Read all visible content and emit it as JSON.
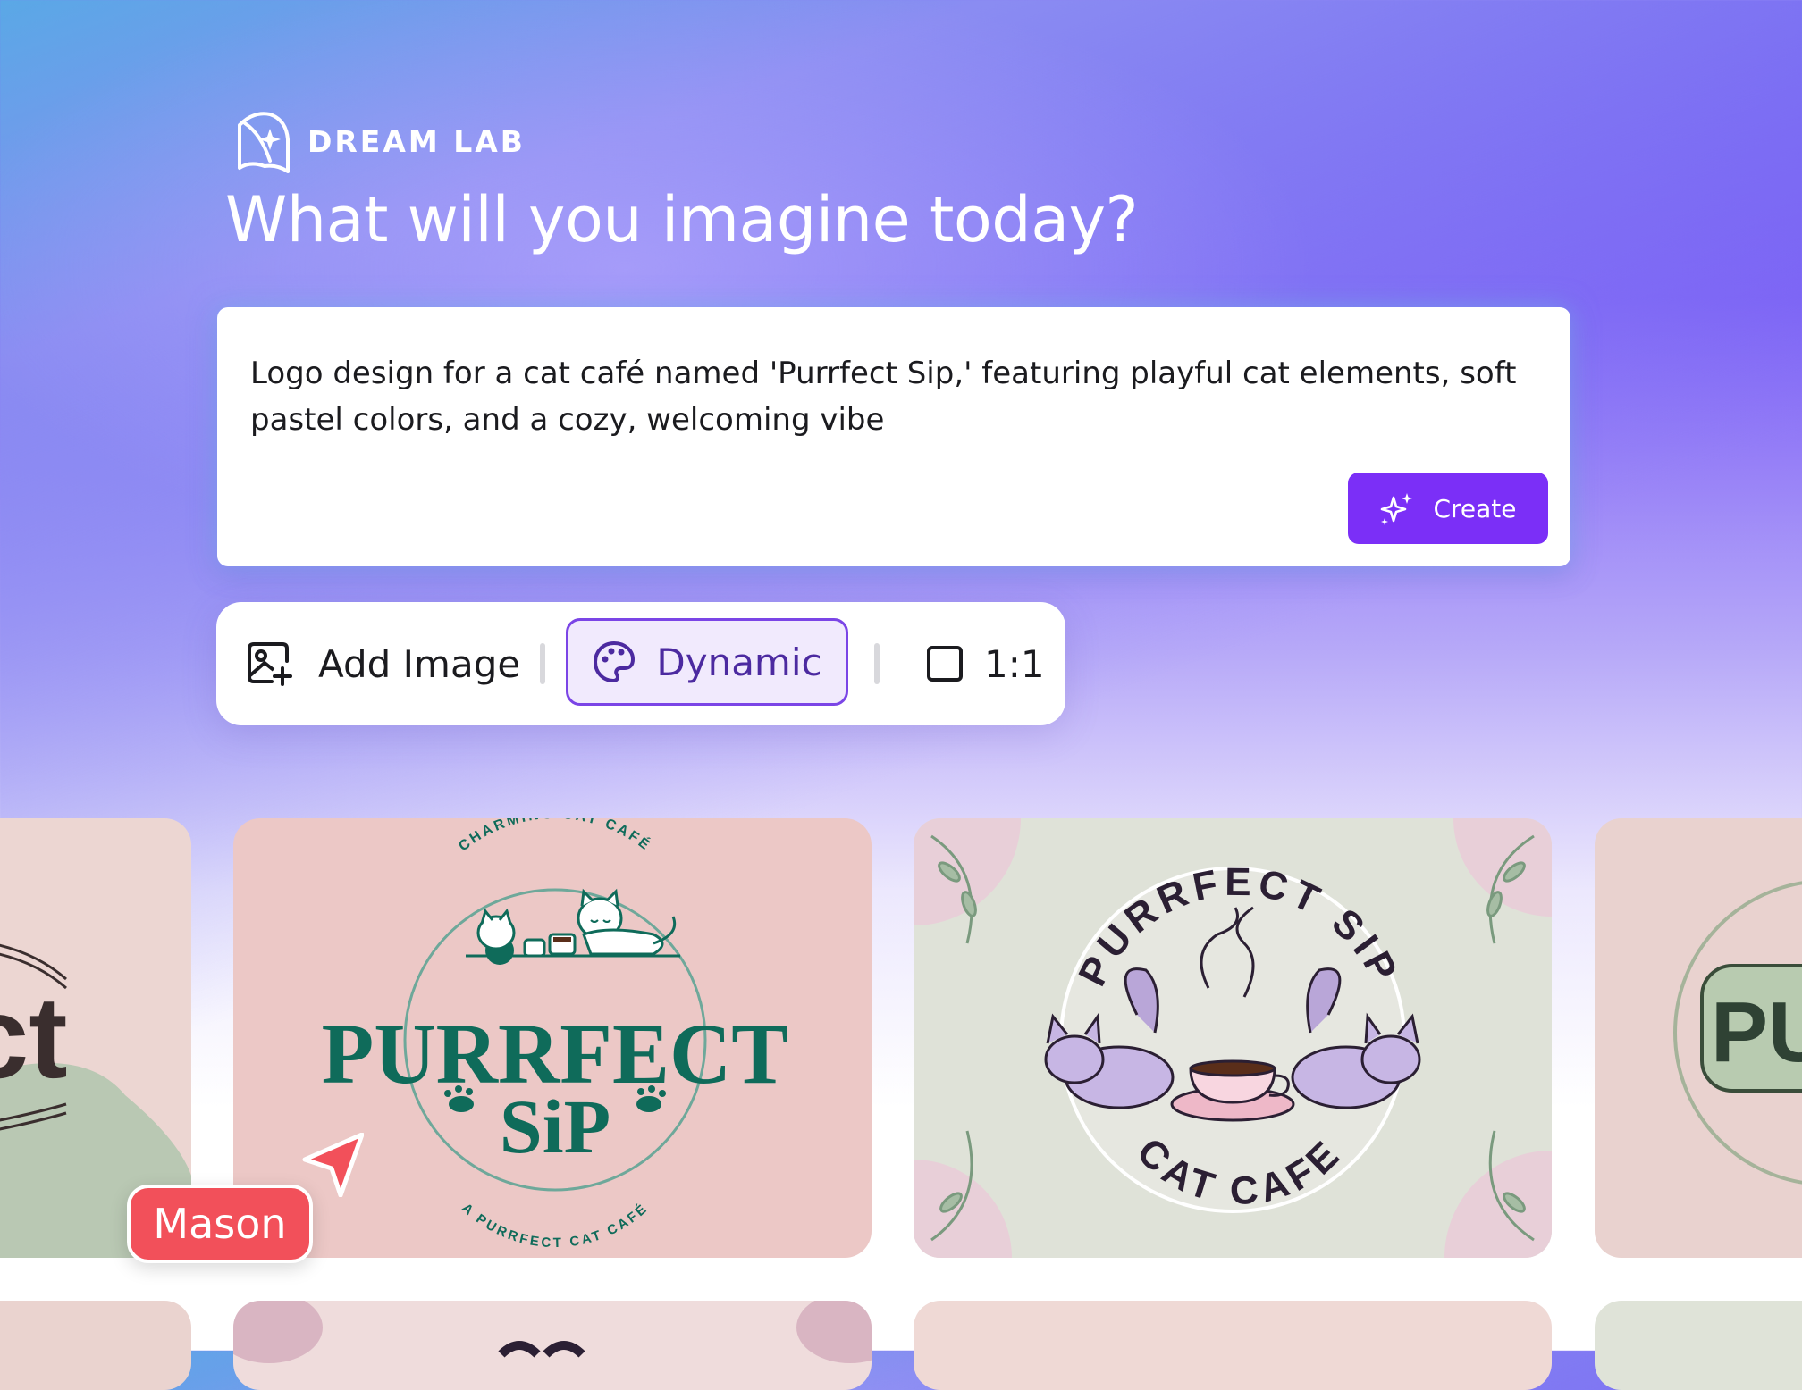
{
  "brand": {
    "name": "DREAM LAB",
    "logo_icon": "dream-lab-logo-icon"
  },
  "headline": "What will you imagine today?",
  "prompt": {
    "text": "Logo design for a cat café named 'Purrfect Sip,' featuring playful cat elements, soft pastel colors, and a cozy, welcoming vibe",
    "create_label": "Create",
    "create_icon": "sparkles-icon"
  },
  "toolbar": {
    "add_image_label": "Add Image",
    "add_image_icon": "image-add-icon",
    "style_label": "Dynamic",
    "style_icon": "palette-icon",
    "ratio_label": "1:1",
    "ratio_icon": "square-icon"
  },
  "results": {
    "card1": {
      "top": "CHARMING CAT CAFÉ",
      "title1": "PURRFECT",
      "title2": "SiP",
      "bottom": "A PURRFECT CAT CAFÉ"
    },
    "card2": {
      "top": "PURRFECT SIP",
      "bottom": "CAT CAFE"
    },
    "partial_left": "ct",
    "partial_right": "PU"
  },
  "collaborator": {
    "name": "Mason"
  },
  "colors": {
    "accent": "#7b2ff7",
    "card_pink": "#ecc8c6",
    "card_sage": "#dfe2d8",
    "logo_green": "#0f6b5a",
    "cursor_red": "#f2505a"
  }
}
